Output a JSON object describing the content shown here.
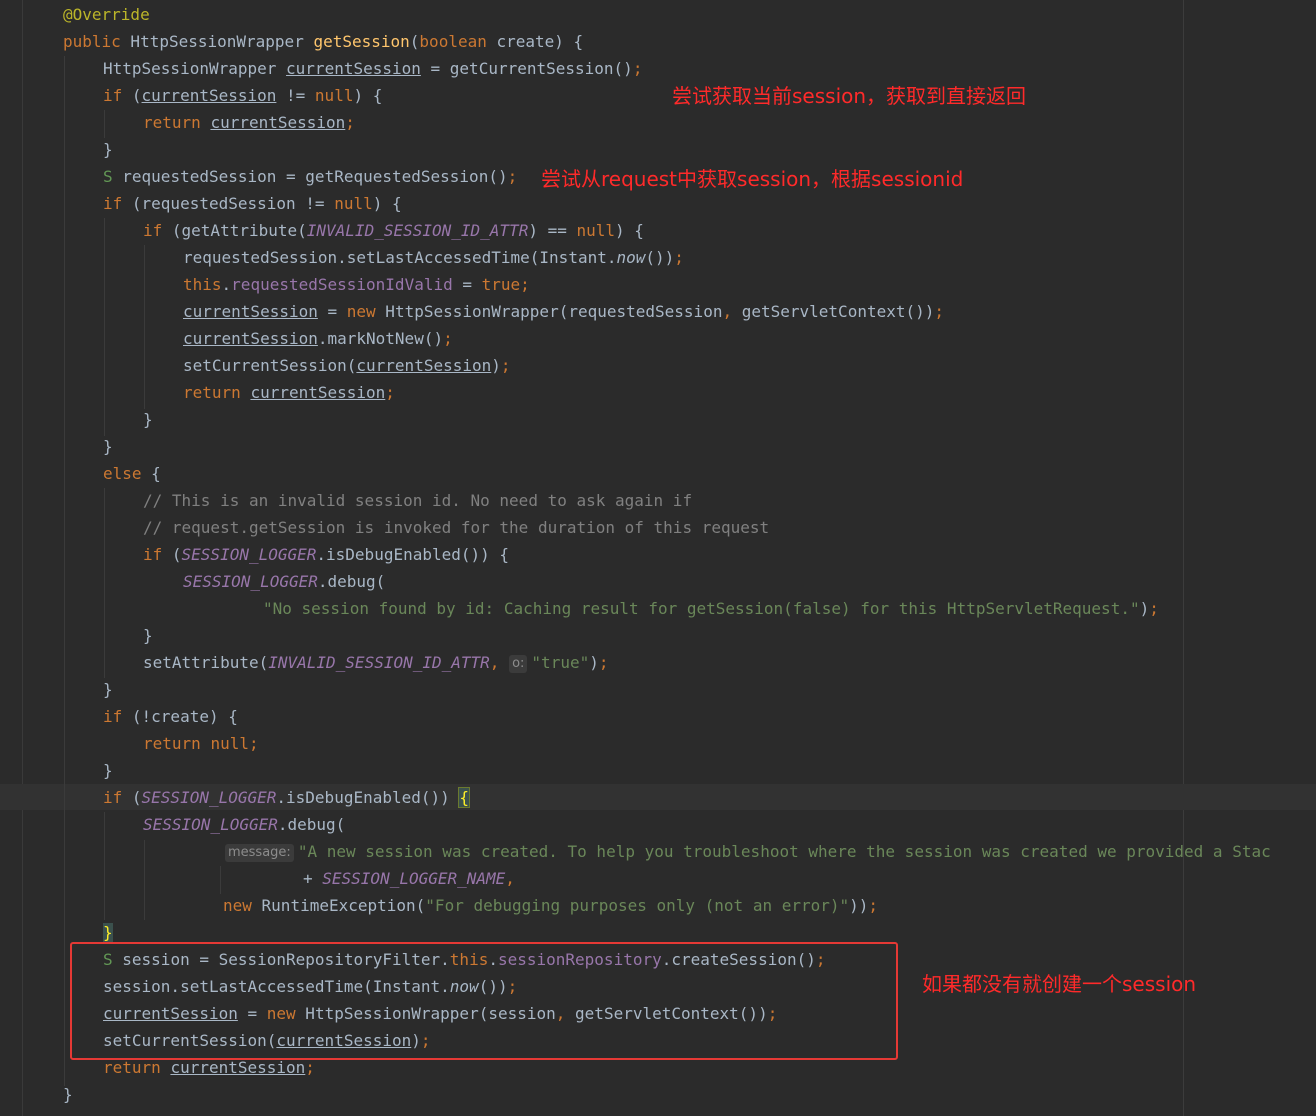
{
  "accent": {
    "annotation_color": "#ff2a2a",
    "box_color": "#e53935",
    "keyword_color": "#cc7832",
    "string_color": "#6a8759"
  },
  "code": {
    "l1_ann": "@Override",
    "l2_kw": "public",
    "l2_type": " HttpSessionWrapper ",
    "l2_name": "getSession",
    "l2_kw2": "boolean",
    "l2_rest": " create) {",
    "l3_type": "HttpSessionWrapper ",
    "l3_var": "currentSession",
    "l3_rest": " = getCurrentSession()",
    "semi": ";",
    "if_kw": "if",
    "l4_var": "currentSession",
    "l4_mid": " != ",
    "null_kw": "null",
    "l4_end": ") {",
    "return_kw": "return",
    "l5_var": "currentSession",
    "close_brace": "}",
    "l7_glyph": "S",
    "l7_rest": " requestedSession = getRequestedSession()",
    "l8_rest": " (requestedSession != ",
    "l9_start": " (getAttribute(",
    "const_invalid": "INVALID_SESSION_ID_ATTR",
    "l9_mid": ") == ",
    "l10_start": "requestedSession.setLastAccessedTime(Instant.",
    "now": "now",
    "l10_end": "())",
    "this_kw": "this",
    "l11_field": "requestedSessionIdValid",
    "l11_mid": " = ",
    "true_kw": "true",
    "l12_var": "currentSession",
    "l12_mid": " = ",
    "new_kw": "new",
    "l12_rest": " HttpSessionWrapper(requestedSession",
    "comma": ",",
    "l12_rest2": " getServletContext())",
    "l13_var": "currentSession",
    "l13_rest": ".markNotNew()",
    "l14_start": "setCurrentSession(",
    "l14_var": "currentSession",
    "l14_end": ")",
    "l15_var": "currentSession",
    "else_kw": "else",
    "open_brace": " {",
    "comment1": "// This is an invalid session id. No need to ask again if",
    "comment2": "// request.getSession is invoked for the duration of this request",
    "const_logger": "SESSION_LOGGER",
    "l21_rest": ".isDebugEnabled()) {",
    "l22_rest": ".debug(",
    "l23_str": "\"No session found by id: Caching result for getSession(false) for this HttpServletRequest.\"",
    "l23_end": ")",
    "l25_start": "setAttribute(",
    "hint_o": "o:",
    "str_true": "\"true\"",
    "l28_rest": " (!create) {",
    "l31_rest": ".isDebugEnabled()) ",
    "brace_open": "{",
    "hint_message": "message:",
    "l33_str": "\"A new session was created. To help you troubleshoot where the session was created we provided a Stac",
    "l34_plus": "+ ",
    "const_logger_name": "SESSION_LOGGER_NAME",
    "l35_rest": " RuntimeException(",
    "l35_str": "\"For debugging purposes only (not an error)\"",
    "l35_end": "))",
    "l37_start": " session = SessionRepositoryFilter.",
    "dot": ".",
    "l37_field": "sessionRepository",
    "l37_end": ".createSession()",
    "l38_start": "session.setLastAccessedTime(Instant.",
    "l39_var": "currentSession",
    "l39_rest": " HttpSessionWrapper(session",
    "l40_var": "currentSession",
    "l41_var": "currentSession"
  },
  "annotations": {
    "a1": "尝试获取当前session，获取到直接返回",
    "a2": "尝试从request中获取session，根据sessionid",
    "a3": "如果都没有就创建一个session"
  }
}
